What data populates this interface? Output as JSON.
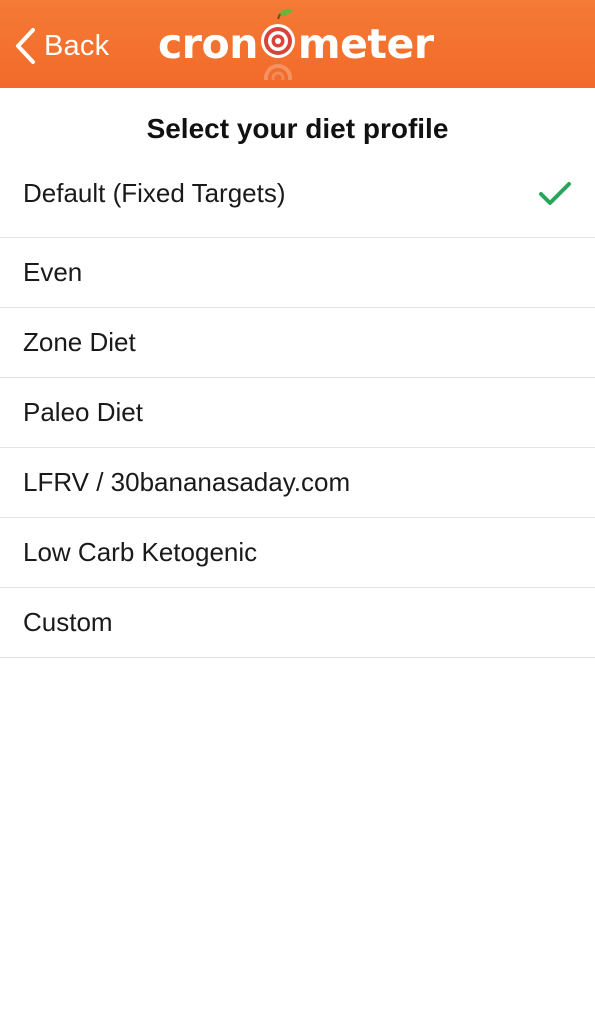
{
  "navbar": {
    "back_label": "Back",
    "logo_text_left": "cron",
    "logo_text_right": "meter",
    "background_color": "#f26a2a"
  },
  "page": {
    "title": "Select your diet profile"
  },
  "diet_profiles": [
    {
      "label": "Default (Fixed Targets)",
      "selected": true
    },
    {
      "label": "Even",
      "selected": false
    },
    {
      "label": "Zone Diet",
      "selected": false
    },
    {
      "label": "Paleo Diet",
      "selected": false
    },
    {
      "label": "LFRV / 30bananasaday.com",
      "selected": false
    },
    {
      "label": "Low Carb Ketogenic",
      "selected": false
    },
    {
      "label": "Custom",
      "selected": false
    }
  ],
  "icons": {
    "back": "chevron-left-icon",
    "selected": "checkmark-icon",
    "logo": "apple-target-logo-icon"
  },
  "colors": {
    "check": "#27a55a",
    "separator": "#e3e3e6"
  }
}
